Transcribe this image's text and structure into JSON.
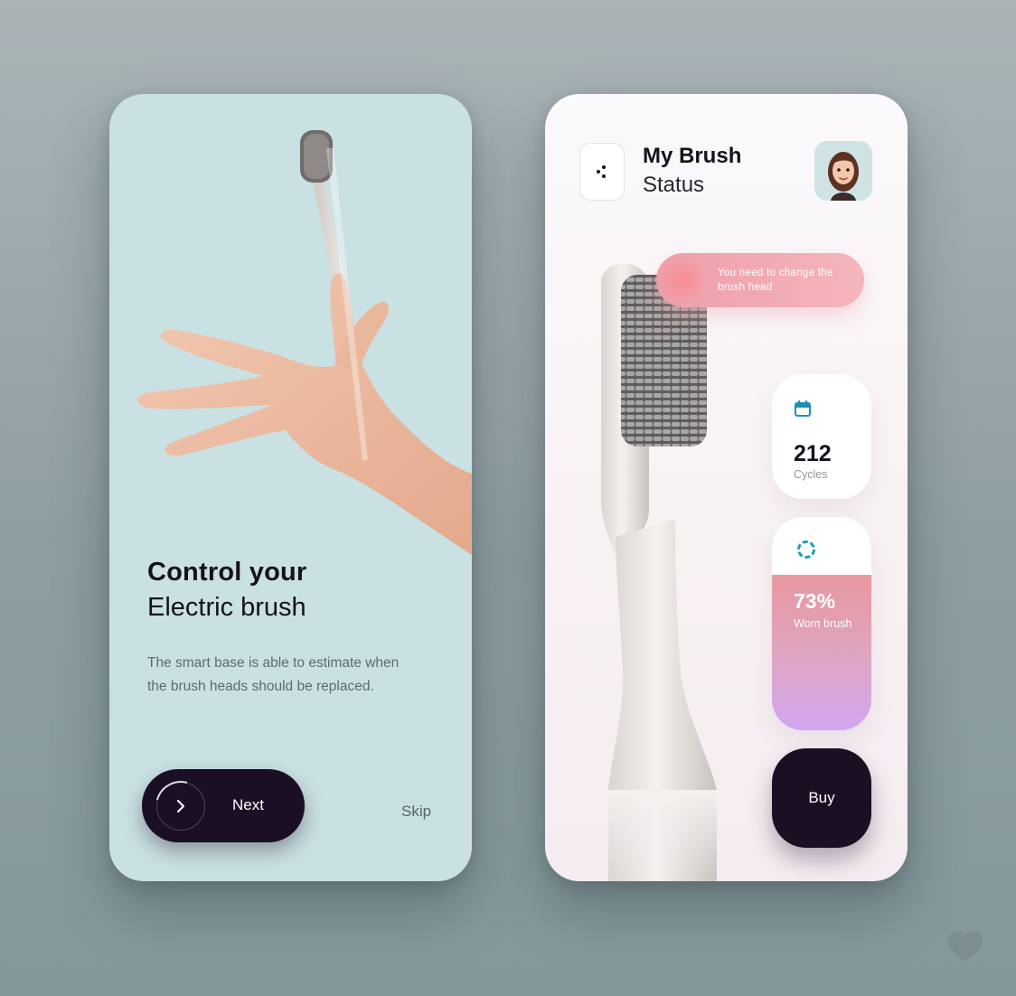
{
  "onboarding": {
    "headline_bold": "Control your",
    "headline_light": "Electric brush",
    "description": "The smart base is able to estimate when the brush heads should be replaced.",
    "next_label": "Next",
    "skip_label": "Skip"
  },
  "status": {
    "title_bold": "My Brush",
    "title_light": "Status",
    "alert_text": "You need to change the brush head",
    "cycles_value": "212",
    "cycles_label": "Cycles",
    "worn_value": "73%",
    "worn_fraction": 0.73,
    "worn_label": "Worn brush",
    "buy_label": "Buy"
  },
  "icons": [
    "chevron-right-icon",
    "menu-dots-icon",
    "calendar-icon",
    "progress-ring-icon",
    "heart-icon"
  ],
  "colors": {
    "left_background": "#c9e1e3",
    "primary_dark": "#1b0f24",
    "alert_pink": "#ef9ea8",
    "worn_gradient_end": "#d2a6f2"
  }
}
